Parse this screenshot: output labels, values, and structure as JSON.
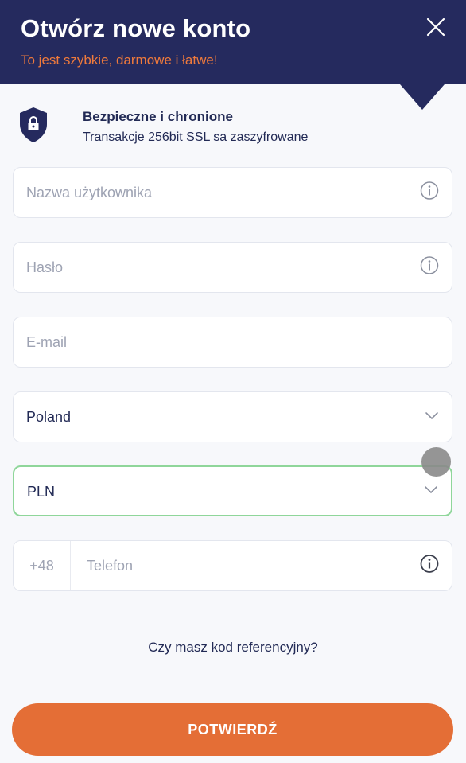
{
  "header": {
    "title": "Otwórz nowe konto",
    "subtitle": "To jest szybkie, darmowe i łatwe!",
    "close_icon": "close-icon"
  },
  "security": {
    "icon": "shield-lock-icon",
    "title": "Bezpieczne i chronione",
    "text": "Transakcje 256bit SSL sa zaszyfrowane"
  },
  "form": {
    "username": {
      "value": "",
      "placeholder": "Nazwa użytkownika",
      "icon": "info-icon"
    },
    "password": {
      "value": "",
      "placeholder": "Hasło",
      "icon": "info-icon"
    },
    "email": {
      "value": "",
      "placeholder": "E-mail"
    },
    "country": {
      "selected": "Poland",
      "icon": "chevron-down-icon"
    },
    "currency": {
      "selected": "PLN",
      "icon": "chevron-down-icon",
      "focused": true
    },
    "phone": {
      "prefix": "+48",
      "value": "",
      "placeholder": "Telefon",
      "icon": "info-icon"
    }
  },
  "referral_link": "Czy masz kod referencyjny?",
  "submit_label": "POTWIERDŹ",
  "colors": {
    "header_bg": "#252a5e",
    "accent": "#ef7a3c",
    "button": "#e46e36",
    "focus_border": "#8fd69a",
    "text": "#222a55",
    "placeholder": "#9ea3b3"
  }
}
